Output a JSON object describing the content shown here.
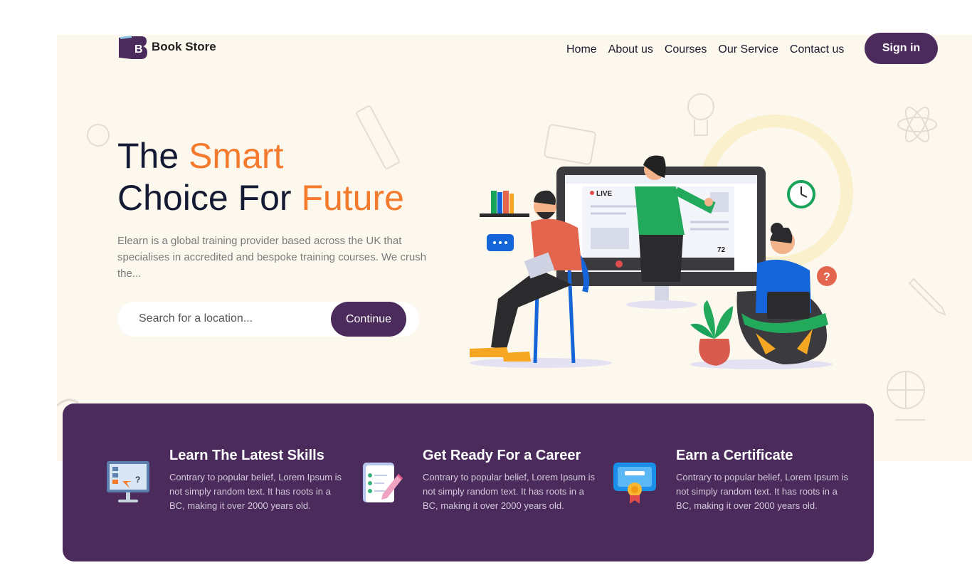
{
  "brand": {
    "name": "Book Store",
    "letter": "B"
  },
  "nav": {
    "items": [
      "Home",
      "About us",
      "Courses",
      "Our Service",
      "Contact us"
    ]
  },
  "auth": {
    "signin_label": "Sign in"
  },
  "hero": {
    "title_part1": "The ",
    "title_accent1": "Smart",
    "title_part2": "Choice For ",
    "title_accent2": "Future",
    "description": "Elearn is a global training provider based across the UK that specialises in accredited and bespoke training courses. We crush the...",
    "search_placeholder": "Search for a location...",
    "continue_label": "Continue"
  },
  "illustration": {
    "live_label": "LIVE",
    "viewer_count": "72"
  },
  "features": [
    {
      "title": "Learn The Latest Skills",
      "text": "Contrary to popular belief, Lorem Ipsum is not simply random text. It has roots in a BC, making it over 2000 years old.",
      "icon": "presentation-board-icon"
    },
    {
      "title": "Get Ready For a Career",
      "text": "Contrary to popular belief, Lorem Ipsum is not simply random text. It has roots in a BC, making it over 2000 years old.",
      "icon": "checklist-pencil-icon"
    },
    {
      "title": "Earn a Certificate",
      "text": "Contrary to popular belief, Lorem Ipsum is not simply random text. It has roots in a BC, making it over 2000 years old.",
      "icon": "certificate-icon"
    }
  ],
  "colors": {
    "primary": "#4b2a5c",
    "accent": "#f47a2e",
    "hero_bg": "#fdf8ee",
    "heading": "#141a33"
  }
}
